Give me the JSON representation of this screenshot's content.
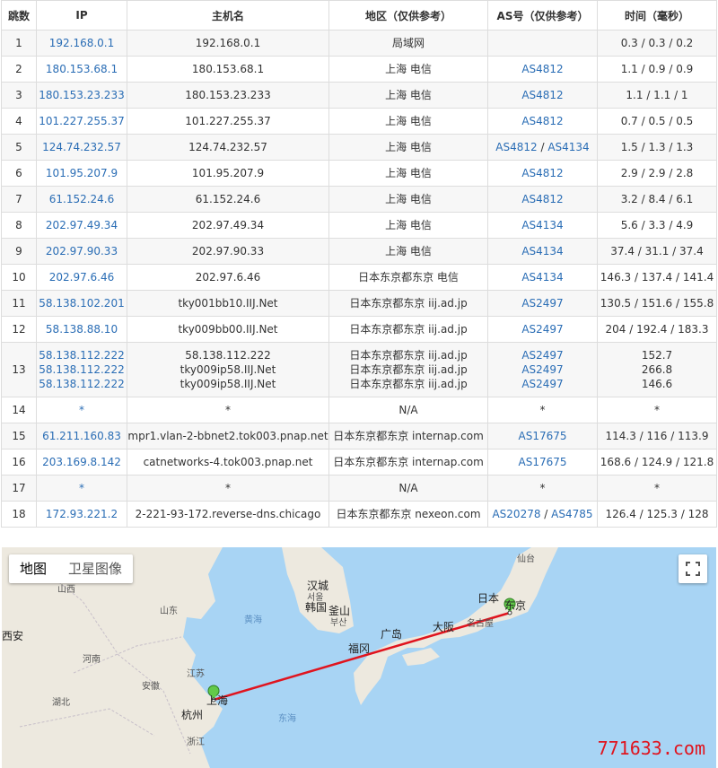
{
  "table": {
    "headers": [
      "跳数",
      "IP",
      "主机名",
      "地区（仅供参考）",
      "AS号（仅供参考）",
      "时间（毫秒）"
    ],
    "rows": [
      {
        "hop": "1",
        "ip": [
          "192.168.0.1"
        ],
        "host": [
          "192.168.0.1"
        ],
        "region": [
          "局域网"
        ],
        "as": [
          []
        ],
        "time": [
          "0.3 / 0.3 / 0.2"
        ]
      },
      {
        "hop": "2",
        "ip": [
          "180.153.68.1"
        ],
        "host": [
          "180.153.68.1"
        ],
        "region": [
          "上海 电信"
        ],
        "as": [
          [
            "AS4812"
          ]
        ],
        "time": [
          "1.1 / 0.9 / 0.9"
        ]
      },
      {
        "hop": "3",
        "ip": [
          "180.153.23.233"
        ],
        "host": [
          "180.153.23.233"
        ],
        "region": [
          "上海 电信"
        ],
        "as": [
          [
            "AS4812"
          ]
        ],
        "time": [
          "1.1 / 1.1 / 1"
        ]
      },
      {
        "hop": "4",
        "ip": [
          "101.227.255.37"
        ],
        "host": [
          "101.227.255.37"
        ],
        "region": [
          "上海 电信"
        ],
        "as": [
          [
            "AS4812"
          ]
        ],
        "time": [
          "0.7 / 0.5 / 0.5"
        ]
      },
      {
        "hop": "5",
        "ip": [
          "124.74.232.57"
        ],
        "host": [
          "124.74.232.57"
        ],
        "region": [
          "上海 电信"
        ],
        "as": [
          [
            "AS4812",
            "AS4134"
          ]
        ],
        "time": [
          "1.5 / 1.3 / 1.3"
        ]
      },
      {
        "hop": "6",
        "ip": [
          "101.95.207.9"
        ],
        "host": [
          "101.95.207.9"
        ],
        "region": [
          "上海 电信"
        ],
        "as": [
          [
            "AS4812"
          ]
        ],
        "time": [
          "2.9 / 2.9 / 2.8"
        ]
      },
      {
        "hop": "7",
        "ip": [
          "61.152.24.6"
        ],
        "host": [
          "61.152.24.6"
        ],
        "region": [
          "上海 电信"
        ],
        "as": [
          [
            "AS4812"
          ]
        ],
        "time": [
          "3.2 / 8.4 / 6.1"
        ]
      },
      {
        "hop": "8",
        "ip": [
          "202.97.49.34"
        ],
        "host": [
          "202.97.49.34"
        ],
        "region": [
          "上海 电信"
        ],
        "as": [
          [
            "AS4134"
          ]
        ],
        "time": [
          "5.6 / 3.3 / 4.9"
        ]
      },
      {
        "hop": "9",
        "ip": [
          "202.97.90.33"
        ],
        "host": [
          "202.97.90.33"
        ],
        "region": [
          "上海 电信"
        ],
        "as": [
          [
            "AS4134"
          ]
        ],
        "time": [
          "37.4 / 31.1 / 37.4"
        ]
      },
      {
        "hop": "10",
        "ip": [
          "202.97.6.46"
        ],
        "host": [
          "202.97.6.46"
        ],
        "region": [
          "日本东京都东京 电信"
        ],
        "as": [
          [
            "AS4134"
          ]
        ],
        "time": [
          "146.3 / 137.4 / 141.4"
        ]
      },
      {
        "hop": "11",
        "ip": [
          "58.138.102.201"
        ],
        "host": [
          "tky001bb10.IIJ.Net"
        ],
        "region": [
          "日本东京都东京 iij.ad.jp"
        ],
        "as": [
          [
            "AS2497"
          ]
        ],
        "time": [
          "130.5 / 151.6 / 155.8"
        ]
      },
      {
        "hop": "12",
        "ip": [
          "58.138.88.10"
        ],
        "host": [
          "tky009bb00.IIJ.Net"
        ],
        "region": [
          "日本东京都东京 iij.ad.jp"
        ],
        "as": [
          [
            "AS2497"
          ]
        ],
        "time": [
          "204 / 192.4 / 183.3"
        ]
      },
      {
        "hop": "13",
        "ip": [
          "58.138.112.222",
          "58.138.112.222",
          "58.138.112.222"
        ],
        "host": [
          "58.138.112.222",
          "tky009ip58.IIJ.Net",
          "tky009ip58.IIJ.Net"
        ],
        "region": [
          "日本东京都东京 iij.ad.jp",
          "日本东京都东京 iij.ad.jp",
          "日本东京都东京 iij.ad.jp"
        ],
        "as": [
          [
            "AS2497"
          ],
          [
            "AS2497"
          ],
          [
            "AS2497"
          ]
        ],
        "time": [
          "152.7",
          "266.8",
          "146.6"
        ]
      },
      {
        "hop": "14",
        "ip": [
          "*"
        ],
        "host": [
          "*"
        ],
        "region": [
          "N/A"
        ],
        "as": [
          [
            "*"
          ]
        ],
        "time": [
          "*"
        ]
      },
      {
        "hop": "15",
        "ip": [
          "61.211.160.83"
        ],
        "host": [
          "mpr1.vlan-2-bbnet2.tok003.pnap.net"
        ],
        "region": [
          "日本东京都东京 internap.com"
        ],
        "as": [
          [
            "AS17675"
          ]
        ],
        "time": [
          "114.3 / 116 / 113.9"
        ]
      },
      {
        "hop": "16",
        "ip": [
          "203.169.8.142"
        ],
        "host": [
          "catnetworks-4.tok003.pnap.net"
        ],
        "region": [
          "日本东京都东京 internap.com"
        ],
        "as": [
          [
            "AS17675"
          ]
        ],
        "time": [
          "168.6 / 124.9 / 121.8"
        ]
      },
      {
        "hop": "17",
        "ip": [
          "*"
        ],
        "host": [
          "*"
        ],
        "region": [
          "N/A"
        ],
        "as": [
          [
            "*"
          ]
        ],
        "time": [
          "*"
        ]
      },
      {
        "hop": "18",
        "ip": [
          "172.93.221.2"
        ],
        "host": [
          "2-221-93-172.reverse-dns.chicago"
        ],
        "region": [
          "日本东京都东京 nexeon.com"
        ],
        "as": [
          [
            "AS20278",
            "AS4785"
          ]
        ],
        "time": [
          "126.4 / 125.3 / 128"
        ]
      }
    ]
  },
  "map": {
    "type_buttons": {
      "map": "地图",
      "satellite": "卫星图像"
    },
    "fullscreen_icon": "fullscreen-icon",
    "route_color": "#e0141e",
    "labels": {
      "sendai": "仙台",
      "seoul": "汉城",
      "seoul_kr": "서울",
      "korea": "韩国",
      "busan": "釜山",
      "busan_kr": "부산",
      "japan": "日本",
      "tokyo": "东京",
      "hiroshima": "广岛",
      "osaka": "大阪",
      "nagoya": "名古屋",
      "fukuoka": "福冈",
      "shanxi": "山西",
      "shandong": "山东",
      "yellow_sea": "黄海",
      "henan": "河南",
      "jiangsu": "江苏",
      "anhui": "安徽",
      "shanghai": "上海",
      "hangzhou": "杭州",
      "hubei": "湖北",
      "zhejiang": "浙江",
      "east_sea": "东海",
      "xian": "西安"
    },
    "watermark": "771633.com"
  }
}
